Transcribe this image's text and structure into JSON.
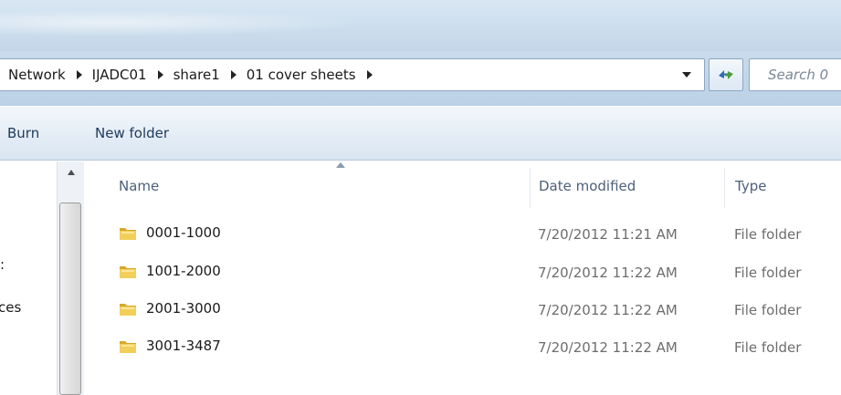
{
  "address_bar": {
    "breadcrumbs": [
      "Network",
      "IJADC01",
      "share1",
      "01 cover sheets"
    ],
    "search_placeholder": "Search 0"
  },
  "command_bar": {
    "burn_label": "Burn",
    "new_folder_label": "New folder"
  },
  "nav_pane": {
    "partial_items": [
      ":",
      "ces"
    ]
  },
  "columns": {
    "name": "Name",
    "date_modified": "Date modified",
    "type": "Type"
  },
  "files": [
    {
      "name": "0001-1000",
      "date_modified": "7/20/2012 11:21 AM",
      "type": "File folder"
    },
    {
      "name": "1001-2000",
      "date_modified": "7/20/2012 11:22 AM",
      "type": "File folder"
    },
    {
      "name": "2001-3000",
      "date_modified": "7/20/2012 11:22 AM",
      "type": "File folder"
    },
    {
      "name": "3001-3487",
      "date_modified": "7/20/2012 11:22 AM",
      "type": "File folder"
    }
  ],
  "icons": {
    "folder": "folder-icon",
    "refresh": "refresh-icon",
    "dropdown": "chevron-down-icon",
    "scroll_up": "scroll-up-icon"
  }
}
